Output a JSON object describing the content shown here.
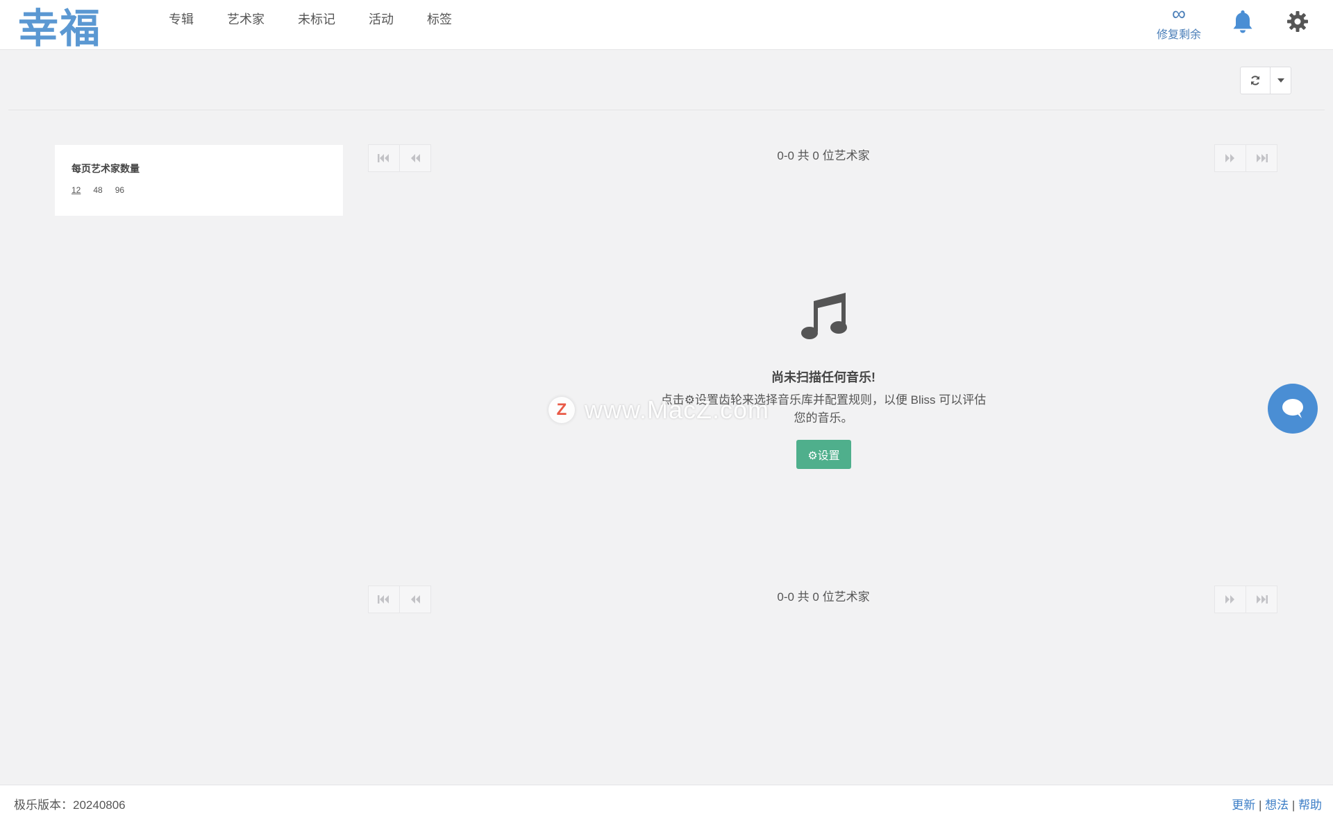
{
  "app": {
    "logo": "幸福"
  },
  "nav": {
    "items": [
      {
        "label": "专辑"
      },
      {
        "label": "艺术家"
      },
      {
        "label": "未标记"
      },
      {
        "label": "活动"
      },
      {
        "label": "标签"
      }
    ]
  },
  "header": {
    "repair_symbol": "∞",
    "repair_label": "修复剩余",
    "icons": [
      "bell-icon",
      "gear-icon"
    ]
  },
  "toolbar": {
    "refresh_icon": "refresh-icon",
    "dropdown_icon": "caret-down-icon"
  },
  "perpage": {
    "title": "每页艺术家数量",
    "options": [
      "12",
      "48",
      "96"
    ],
    "selected": "12"
  },
  "pager": {
    "count_text": "0-0 共 0 位艺术家"
  },
  "empty": {
    "title": "尚未扫描任何音乐!",
    "text": "点击⚙设置齿轮来选择音乐库并配置规则，以便 Bliss 可以评估您的音乐。",
    "button": "⚙设置"
  },
  "watermark": {
    "letter": "Z",
    "text": "www.MacZ.com"
  },
  "footer": {
    "version": "极乐版本：20240806",
    "links": [
      "更新",
      "想法",
      "帮助"
    ],
    "separator": "|"
  },
  "colors": {
    "accent": "#5b98d2",
    "button_green": "#4faf8c",
    "chat_blue": "#4a8ed4",
    "link_blue": "#3b7dc6"
  }
}
